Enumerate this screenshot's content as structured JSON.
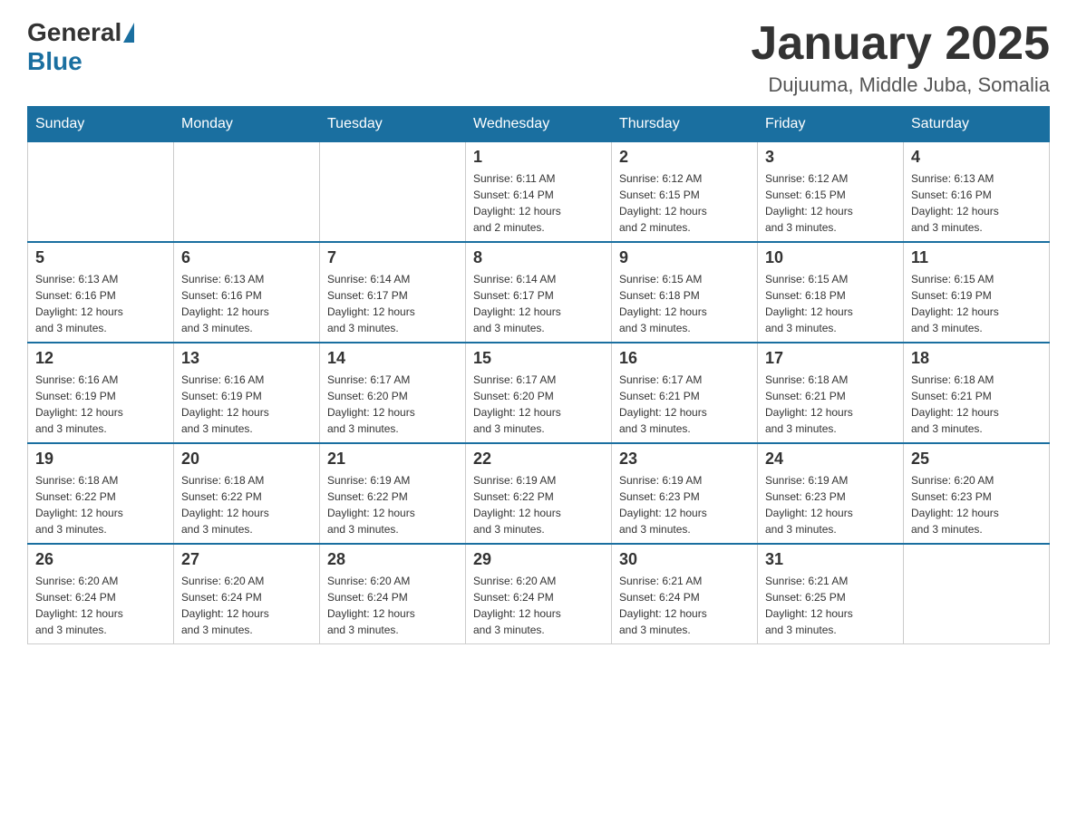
{
  "header": {
    "logo_general": "General",
    "logo_blue": "Blue",
    "month_title": "January 2025",
    "location": "Dujuuma, Middle Juba, Somalia"
  },
  "weekdays": [
    "Sunday",
    "Monday",
    "Tuesday",
    "Wednesday",
    "Thursday",
    "Friday",
    "Saturday"
  ],
  "weeks": [
    [
      {
        "day": "",
        "info": ""
      },
      {
        "day": "",
        "info": ""
      },
      {
        "day": "",
        "info": ""
      },
      {
        "day": "1",
        "info": "Sunrise: 6:11 AM\nSunset: 6:14 PM\nDaylight: 12 hours\nand 2 minutes."
      },
      {
        "day": "2",
        "info": "Sunrise: 6:12 AM\nSunset: 6:15 PM\nDaylight: 12 hours\nand 2 minutes."
      },
      {
        "day": "3",
        "info": "Sunrise: 6:12 AM\nSunset: 6:15 PM\nDaylight: 12 hours\nand 3 minutes."
      },
      {
        "day": "4",
        "info": "Sunrise: 6:13 AM\nSunset: 6:16 PM\nDaylight: 12 hours\nand 3 minutes."
      }
    ],
    [
      {
        "day": "5",
        "info": "Sunrise: 6:13 AM\nSunset: 6:16 PM\nDaylight: 12 hours\nand 3 minutes."
      },
      {
        "day": "6",
        "info": "Sunrise: 6:13 AM\nSunset: 6:16 PM\nDaylight: 12 hours\nand 3 minutes."
      },
      {
        "day": "7",
        "info": "Sunrise: 6:14 AM\nSunset: 6:17 PM\nDaylight: 12 hours\nand 3 minutes."
      },
      {
        "day": "8",
        "info": "Sunrise: 6:14 AM\nSunset: 6:17 PM\nDaylight: 12 hours\nand 3 minutes."
      },
      {
        "day": "9",
        "info": "Sunrise: 6:15 AM\nSunset: 6:18 PM\nDaylight: 12 hours\nand 3 minutes."
      },
      {
        "day": "10",
        "info": "Sunrise: 6:15 AM\nSunset: 6:18 PM\nDaylight: 12 hours\nand 3 minutes."
      },
      {
        "day": "11",
        "info": "Sunrise: 6:15 AM\nSunset: 6:19 PM\nDaylight: 12 hours\nand 3 minutes."
      }
    ],
    [
      {
        "day": "12",
        "info": "Sunrise: 6:16 AM\nSunset: 6:19 PM\nDaylight: 12 hours\nand 3 minutes."
      },
      {
        "day": "13",
        "info": "Sunrise: 6:16 AM\nSunset: 6:19 PM\nDaylight: 12 hours\nand 3 minutes."
      },
      {
        "day": "14",
        "info": "Sunrise: 6:17 AM\nSunset: 6:20 PM\nDaylight: 12 hours\nand 3 minutes."
      },
      {
        "day": "15",
        "info": "Sunrise: 6:17 AM\nSunset: 6:20 PM\nDaylight: 12 hours\nand 3 minutes."
      },
      {
        "day": "16",
        "info": "Sunrise: 6:17 AM\nSunset: 6:21 PM\nDaylight: 12 hours\nand 3 minutes."
      },
      {
        "day": "17",
        "info": "Sunrise: 6:18 AM\nSunset: 6:21 PM\nDaylight: 12 hours\nand 3 minutes."
      },
      {
        "day": "18",
        "info": "Sunrise: 6:18 AM\nSunset: 6:21 PM\nDaylight: 12 hours\nand 3 minutes."
      }
    ],
    [
      {
        "day": "19",
        "info": "Sunrise: 6:18 AM\nSunset: 6:22 PM\nDaylight: 12 hours\nand 3 minutes."
      },
      {
        "day": "20",
        "info": "Sunrise: 6:18 AM\nSunset: 6:22 PM\nDaylight: 12 hours\nand 3 minutes."
      },
      {
        "day": "21",
        "info": "Sunrise: 6:19 AM\nSunset: 6:22 PM\nDaylight: 12 hours\nand 3 minutes."
      },
      {
        "day": "22",
        "info": "Sunrise: 6:19 AM\nSunset: 6:22 PM\nDaylight: 12 hours\nand 3 minutes."
      },
      {
        "day": "23",
        "info": "Sunrise: 6:19 AM\nSunset: 6:23 PM\nDaylight: 12 hours\nand 3 minutes."
      },
      {
        "day": "24",
        "info": "Sunrise: 6:19 AM\nSunset: 6:23 PM\nDaylight: 12 hours\nand 3 minutes."
      },
      {
        "day": "25",
        "info": "Sunrise: 6:20 AM\nSunset: 6:23 PM\nDaylight: 12 hours\nand 3 minutes."
      }
    ],
    [
      {
        "day": "26",
        "info": "Sunrise: 6:20 AM\nSunset: 6:24 PM\nDaylight: 12 hours\nand 3 minutes."
      },
      {
        "day": "27",
        "info": "Sunrise: 6:20 AM\nSunset: 6:24 PM\nDaylight: 12 hours\nand 3 minutes."
      },
      {
        "day": "28",
        "info": "Sunrise: 6:20 AM\nSunset: 6:24 PM\nDaylight: 12 hours\nand 3 minutes."
      },
      {
        "day": "29",
        "info": "Sunrise: 6:20 AM\nSunset: 6:24 PM\nDaylight: 12 hours\nand 3 minutes."
      },
      {
        "day": "30",
        "info": "Sunrise: 6:21 AM\nSunset: 6:24 PM\nDaylight: 12 hours\nand 3 minutes."
      },
      {
        "day": "31",
        "info": "Sunrise: 6:21 AM\nSunset: 6:25 PM\nDaylight: 12 hours\nand 3 minutes."
      },
      {
        "day": "",
        "info": ""
      }
    ]
  ]
}
